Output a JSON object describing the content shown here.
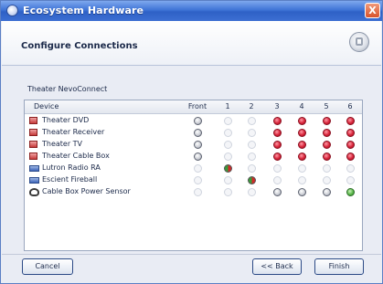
{
  "window": {
    "title": "Ecosystem Hardware",
    "close_label": "X"
  },
  "page": {
    "title": "Configure Connections",
    "section_label": "Theater NevoConnect"
  },
  "grid": {
    "columns": [
      "Device",
      "Front",
      "1",
      "2",
      "3",
      "4",
      "5",
      "6"
    ],
    "rows": [
      {
        "name": "Theater DVD",
        "icon": "av-device-icon",
        "ports": [
          "avail",
          "empty",
          "empty",
          "red",
          "red",
          "red",
          "red"
        ]
      },
      {
        "name": "Theater Receiver",
        "icon": "av-device-icon",
        "ports": [
          "avail",
          "empty",
          "empty",
          "red",
          "red",
          "red",
          "red"
        ]
      },
      {
        "name": "Theater TV",
        "icon": "av-device-icon",
        "ports": [
          "avail",
          "empty",
          "empty",
          "red",
          "red",
          "red",
          "red"
        ]
      },
      {
        "name": "Theater Cable Box",
        "icon": "av-device-icon",
        "ports": [
          "avail",
          "empty",
          "empty",
          "red",
          "red",
          "red",
          "red"
        ]
      },
      {
        "name": "Lutron Radio RA",
        "icon": "lutron-device-icon",
        "ports": [
          "empty",
          "split",
          "empty",
          "empty",
          "empty",
          "empty",
          "empty"
        ]
      },
      {
        "name": "Escient Fireball",
        "icon": "lutron-device-icon",
        "ports": [
          "empty",
          "empty",
          "split",
          "empty",
          "empty",
          "empty",
          "empty"
        ]
      },
      {
        "name": "Cable Box Power Sensor",
        "icon": "sensor-icon",
        "ports": [
          "empty",
          "empty",
          "empty",
          "avail",
          "avail",
          "avail",
          "green"
        ]
      }
    ]
  },
  "buttons": {
    "cancel": "Cancel",
    "back": "<< Back",
    "finish": "Finish"
  }
}
